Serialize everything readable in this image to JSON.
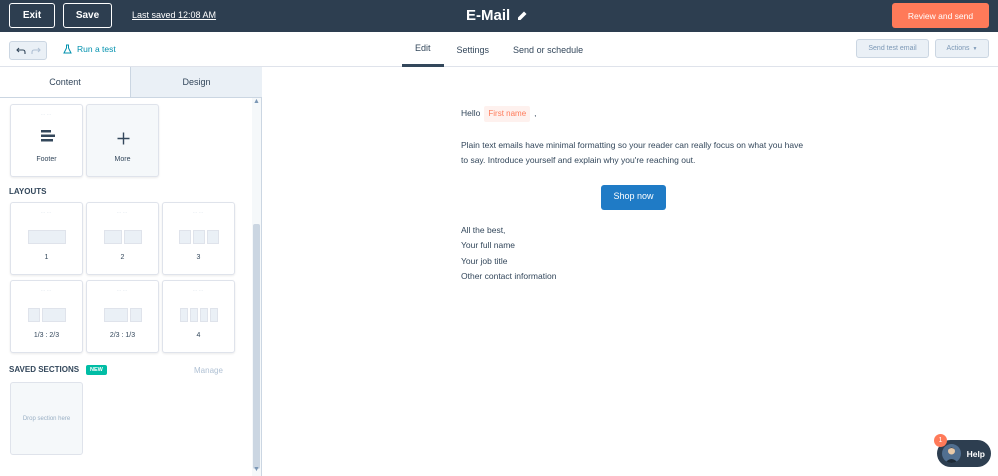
{
  "topbar": {
    "exit_label": "Exit",
    "save_label": "Save",
    "last_saved": "Last saved 12:08 AM",
    "title": "E-Mail",
    "review_label": "Review and send"
  },
  "subbar": {
    "run_test_label": "Run a test",
    "tabs": [
      {
        "label": "Edit"
      },
      {
        "label": "Settings"
      },
      {
        "label": "Send or schedule"
      }
    ],
    "send_test_label": "Send test email",
    "actions_label": "Actions"
  },
  "panel": {
    "tabs": [
      {
        "label": "Content"
      },
      {
        "label": "Design"
      }
    ],
    "modules": [
      {
        "label": "Footer",
        "icon": "footer-icon"
      },
      {
        "label": "More",
        "icon": "plus-icon"
      }
    ],
    "layouts_heading": "LAYOUTS",
    "layouts": [
      {
        "label": "1"
      },
      {
        "label": "2"
      },
      {
        "label": "3"
      },
      {
        "label": "1/3 : 2/3"
      },
      {
        "label": "2/3 : 1/3"
      },
      {
        "label": "4"
      }
    ],
    "saved_heading": "SAVED SECTIONS",
    "new_badge": "NEW",
    "manage_label": "Manage",
    "drop_label": "Drop section here"
  },
  "email": {
    "greeting": "Hello",
    "token": "First name",
    "comma": ",",
    "body": "Plain text emails have minimal formatting so your reader can really focus on what you have to say. Introduce yourself and explain why you're reaching out.",
    "cta": "Shop now",
    "signoff": [
      "All the best,",
      "Your full name",
      "Your job title",
      "Other contact information"
    ]
  },
  "help": {
    "label": "Help",
    "badge": "1"
  },
  "colors": {
    "topbar": "#2d3e50",
    "accent": "#ff7a59",
    "cta": "#1f7bc6",
    "link": "#0091ae",
    "new_badge": "#00bda5"
  }
}
